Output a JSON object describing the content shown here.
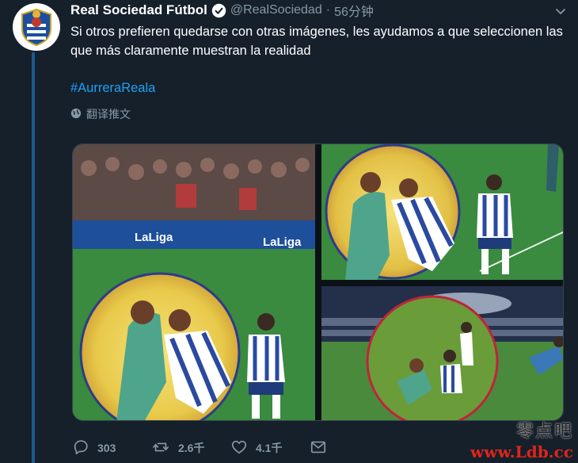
{
  "account": {
    "name": "Real Sociedad Fútbol",
    "handle": "@RealSociedad",
    "separator": "·",
    "time": "56分钟"
  },
  "tweet": {
    "text": "Si otros prefieren quedarse con otras imágenes, les ayudamos a que seleccionen las que más claramente muestran la realidad",
    "hashtag": "#AurreraReala",
    "translate_label": "翻译推文"
  },
  "media": {
    "board_texts": [
      "LaLiga",
      "LaLiga"
    ]
  },
  "actions": {
    "reply_count": "303",
    "retweet_count": "2.6千",
    "like_count": "4.1千"
  },
  "watermark": {
    "line1": "零点吧",
    "line2": "www.Ldb.cc"
  },
  "colors": {
    "background": "#15202b",
    "link": "#1da1f2",
    "muted": "#8899a6",
    "thread": "#1b5a8e"
  }
}
